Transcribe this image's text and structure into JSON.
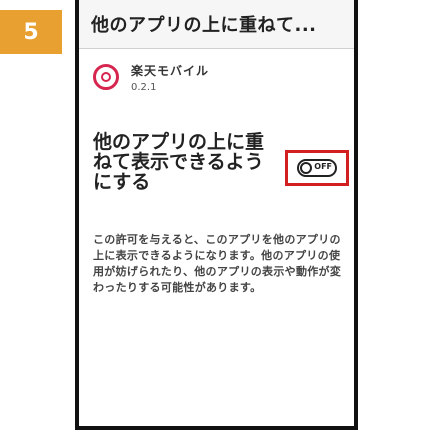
{
  "step": {
    "number": "5"
  },
  "header": {
    "title": "他のアプリの上に重ねて..."
  },
  "app": {
    "icon": "app-logo-icon",
    "name": "楽天モバイル",
    "version": "0.2.1"
  },
  "setting": {
    "label": "他のアプリの上に重ねて表示できるようにする",
    "toggle_state": "OFF",
    "toggle_text": "OFF"
  },
  "description": {
    "text": "この許可を与えると、このアプリを他のアプリの上に表示できるようになります。他のアプリの使用が妨げられたり、他のアプリの表示や動作が変わったりする可能性があります。"
  },
  "colors": {
    "badge": "#e8a030",
    "highlight": "#d21f1f",
    "app_icon": "#d6254f"
  }
}
